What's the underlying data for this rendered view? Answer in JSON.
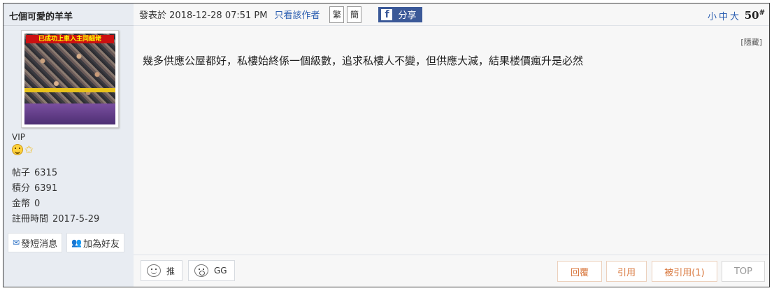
{
  "author": {
    "name": "七個可愛的羊羊",
    "avatar_banner": "已成功上車入主同細佬",
    "rank": "VIP",
    "stats": [
      {
        "label": "帖子",
        "value": "6315"
      },
      {
        "label": "積分",
        "value": "6391"
      },
      {
        "label": "金幣",
        "value": "0"
      },
      {
        "label": "註冊時間",
        "value": "2017-5-29"
      }
    ],
    "send_message": "發短消息",
    "add_friend": "加為好友"
  },
  "header": {
    "posted_label": "發表於 2018-12-28 07:51 PM",
    "author_only": "只看該作者",
    "traditional": "繁",
    "simplified": "簡",
    "share": "分享",
    "font_sizes": "小中大",
    "post_number": "50",
    "post_number_suffix": "#"
  },
  "content": {
    "hidden_tag": "[隱藏]",
    "body": "幾多供應公屋都好，私樓始終係一個級數，追求私樓人不變，但供應大減，結果楼價瘋升是必然"
  },
  "footer": {
    "upvote": "推",
    "downvote": "GG",
    "reply": "回覆",
    "quote": "引用",
    "quoted": "被引用(1)",
    "top": "TOP"
  }
}
